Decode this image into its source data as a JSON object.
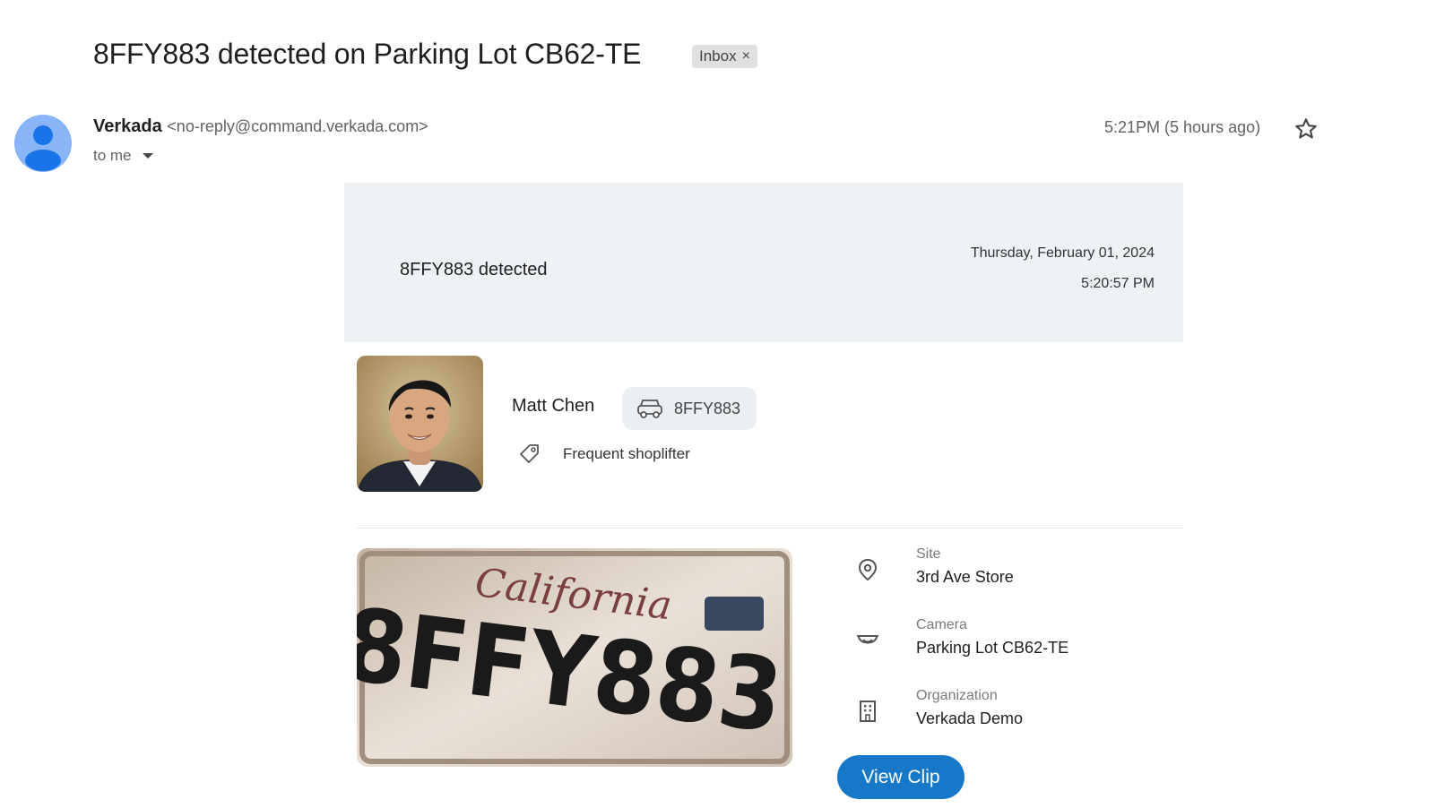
{
  "email": {
    "subject": "8FFY883 detected on Parking Lot CB62-TE",
    "label_chip": "Inbox",
    "label_close": "×",
    "sender_name": "Verkada",
    "sender_email": "<no-reply@command.verkada.com>",
    "recipient": "to me",
    "timestamp": "5:21PM (5 hours ago)"
  },
  "alert": {
    "title": "8FFY883 detected",
    "date": "Thursday, February 01, 2024",
    "time": "5:20:57 PM",
    "person_name": "Matt Chen",
    "plate": "8FFY883",
    "tag": "Frequent shoplifter",
    "plate_image": {
      "top_script": "California",
      "plate_number": "8FFY883"
    },
    "details": [
      {
        "label": "Site",
        "value": "3rd Ave Store",
        "icon": "location-pin-icon"
      },
      {
        "label": "Camera",
        "value": "Parking Lot CB62-TE",
        "icon": "dome-camera-icon"
      },
      {
        "label": "Organization",
        "value": "Verkada Demo",
        "icon": "building-icon"
      }
    ],
    "button_label": "View Clip"
  },
  "colors": {
    "header_bg": "#eef2f5",
    "button_bg": "#1878c8",
    "avatar_bg": "#8ab4f8",
    "chip_bg": "#e0e0e0"
  }
}
